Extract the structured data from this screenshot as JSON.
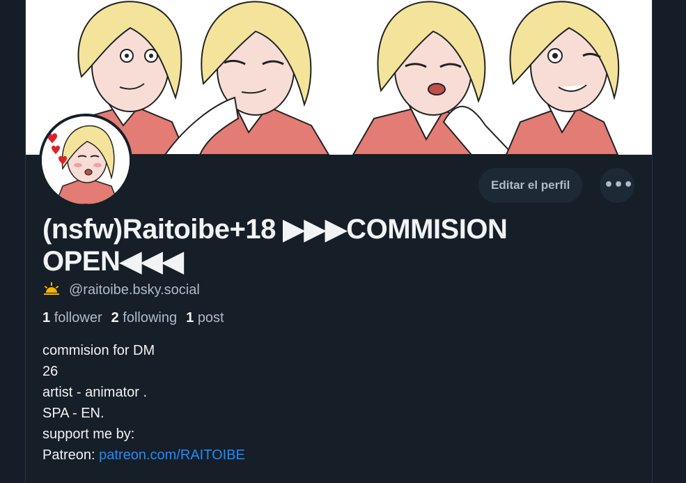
{
  "profile": {
    "display_name_line1": "(nsfw)Raitoibe+18 ▶▶▶COMMISION",
    "display_name_line2": "OPEN◀◀◀",
    "handle": "@raitoibe.bsky.social",
    "handle_icon": "sunrise-icon",
    "stats": {
      "followers_count": "1",
      "followers_label": "follower",
      "following_count": "2",
      "following_label": "following",
      "posts_count": "1",
      "posts_label": "post"
    },
    "bio": {
      "line1": "commision for DM",
      "line2": "26",
      "line3": "artist - animator .",
      "line4": "SPA - EN.",
      "line5": "support me by:",
      "patreon_label": "Patreon:",
      "patreon_link": "patreon.com/RAITOIBE"
    }
  },
  "actions": {
    "edit_label": "Editar el perfil",
    "more_label": "•••"
  },
  "colors": {
    "background": "#161e27",
    "button_bg": "#1e2936",
    "muted_text": "#aebbc9",
    "link": "#208bfe",
    "hair": "#f4e39a",
    "sweater": "#e27c74"
  }
}
